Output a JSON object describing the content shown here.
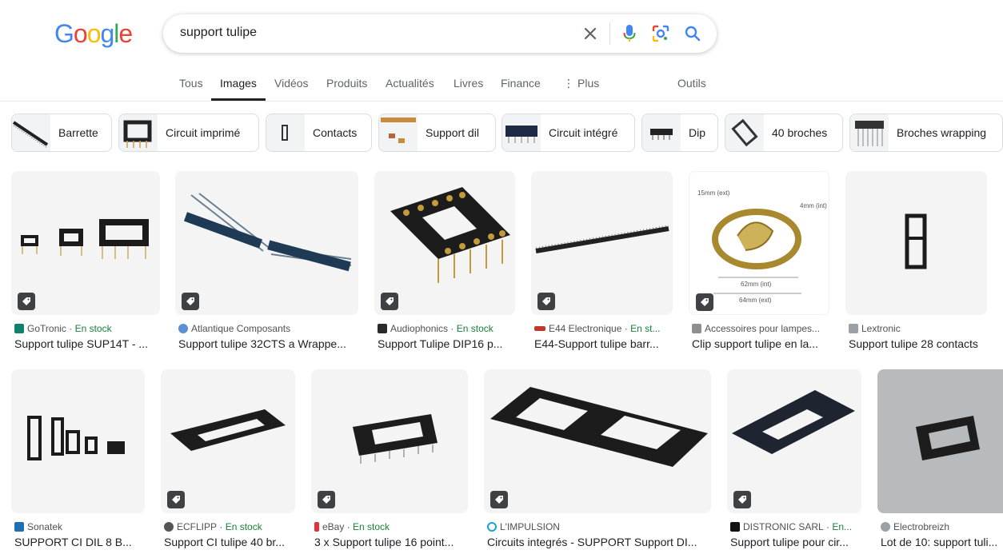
{
  "logo": "Google",
  "search": {
    "query": "support tulipe"
  },
  "tabs": [
    "Tous",
    "Images",
    "Vidéos",
    "Produits",
    "Actualités",
    "Livres",
    "Finance",
    "Plus",
    "Outils"
  ],
  "chips": [
    "Barrette",
    "Circuit imprimé",
    "Contacts",
    "Support dil",
    "Circuit intégré",
    "Dip",
    "40 broches",
    "Broches wrapping"
  ],
  "results_row1": [
    {
      "source": "GoTronic",
      "stock": "En stock",
      "title": "Support tulipe SUP14T - ..."
    },
    {
      "source": "Atlantique Composants",
      "stock": "",
      "title": "Support tulipe 32CTS a Wrappe..."
    },
    {
      "source": "Audiophonics",
      "stock": "En stock",
      "title": "Support Tulipe DIP16 p..."
    },
    {
      "source": "E44 Electronique",
      "stock": "En st...",
      "title": "E44-Support tulipe barr..."
    },
    {
      "source": "Accessoires pour lampes...",
      "stock": "",
      "title": "Clip support tulipe en la...",
      "annotations": [
        "15mm (ext)",
        "4mm (int)",
        "62mm (int)",
        "64mm (ext)"
      ]
    },
    {
      "source": "Lextronic",
      "stock": "",
      "title": "Support tulipe 28 contacts"
    }
  ],
  "results_row2": [
    {
      "source": "Sonatek",
      "stock": "",
      "title": "SUPPORT CI DIL 8 B..."
    },
    {
      "source": "ECFLIPP",
      "stock": "En stock",
      "title": "Support CI tulipe 40 br..."
    },
    {
      "source": "eBay",
      "stock": "En stock",
      "title": "3 x Support tulipe 16 point..."
    },
    {
      "source": "L'IMPULSION",
      "stock": "",
      "title": "Circuits integrés - SUPPORT Support DI..."
    },
    {
      "source": "DISTRONIC SARL",
      "stock": "En...",
      "title": "Support tulipe pour cir..."
    },
    {
      "source": "Electrobreizh",
      "stock": "",
      "title": "Lot de 10: support tuli..."
    }
  ],
  "colors": {
    "blue": "#4285F4",
    "red": "#EA4335",
    "yellow": "#FBBC05",
    "green": "#34A853",
    "stock_green": "#188038"
  }
}
